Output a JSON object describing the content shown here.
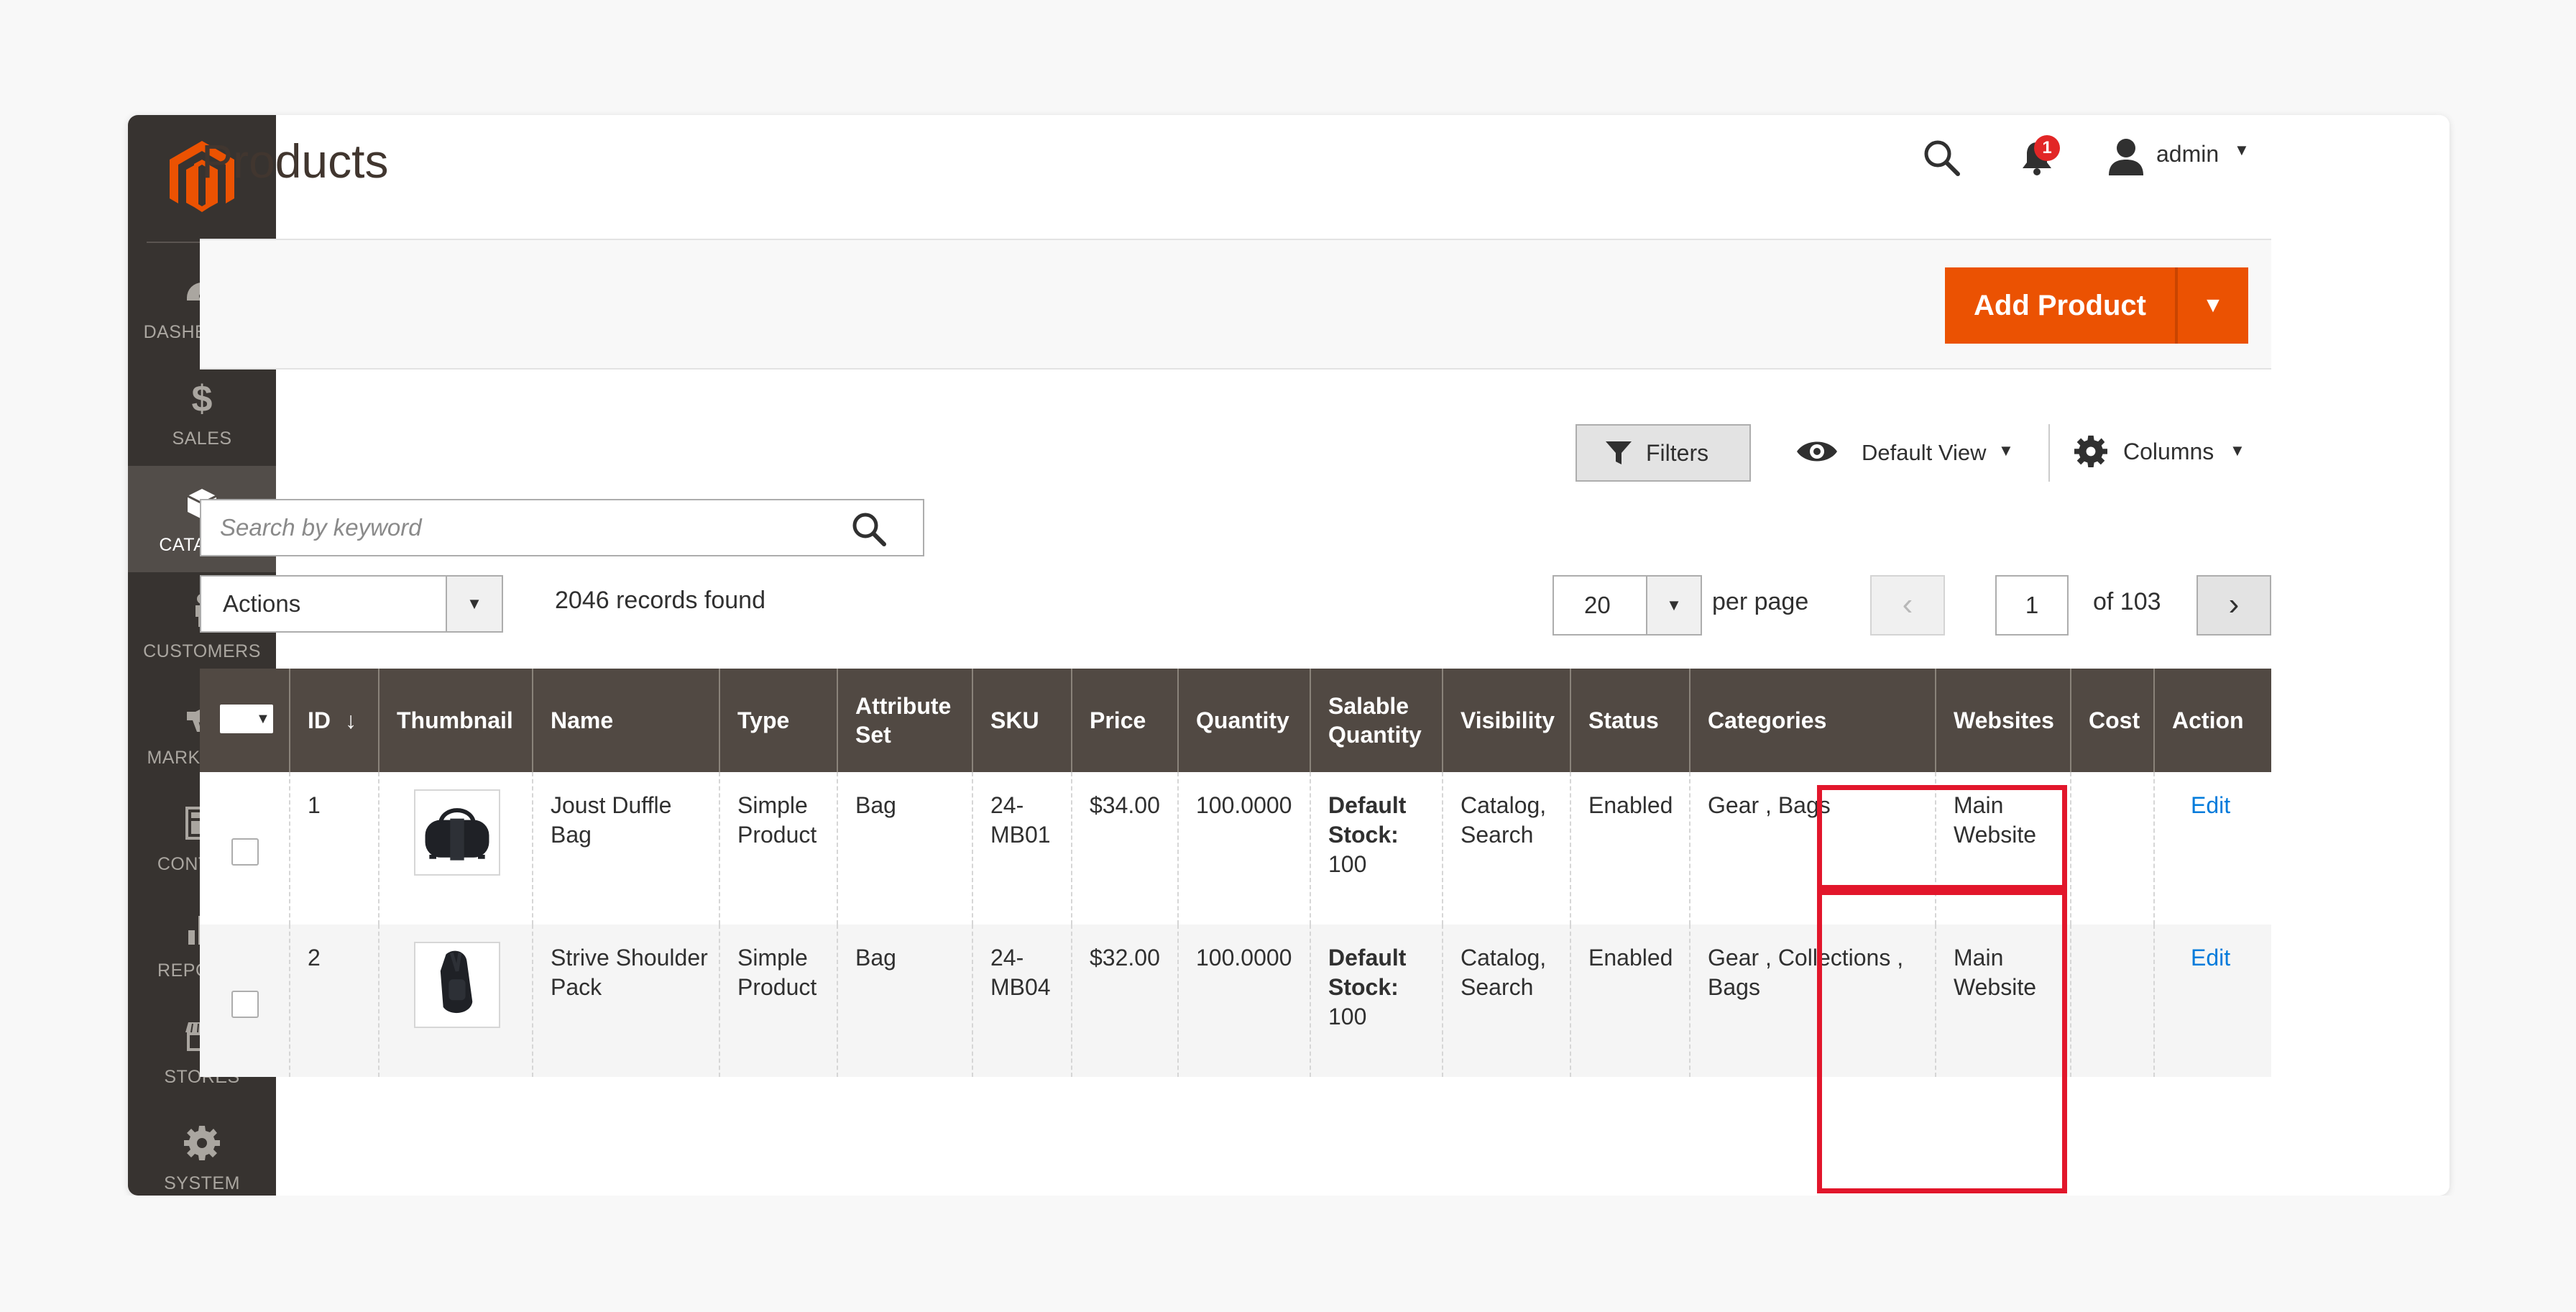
{
  "sidebar": {
    "items": [
      {
        "label": "DASHBOARD",
        "icon": "dashboard-icon"
      },
      {
        "label": "SALES",
        "icon": "dollar-icon"
      },
      {
        "label": "CATALOG",
        "icon": "cube-icon",
        "active": true
      },
      {
        "label": "CUSTOMERS",
        "icon": "person-icon"
      },
      {
        "label": "MARKETING",
        "icon": "megaphone-icon"
      },
      {
        "label": "CONTENT",
        "icon": "layout-icon"
      },
      {
        "label": "REPORTS",
        "icon": "bar-chart-icon"
      },
      {
        "label": "STORES",
        "icon": "storefront-icon"
      },
      {
        "label": "SYSTEM",
        "icon": "gear-icon"
      }
    ]
  },
  "header": {
    "title": "Products",
    "notifications_count": "1",
    "user": "admin"
  },
  "actionbar": {
    "add_product_label": "Add Product"
  },
  "toolbar": {
    "filters_label": "Filters",
    "view_label": "Default View",
    "columns_label": "Columns",
    "search_placeholder": "Search by keyword",
    "actions_label": "Actions",
    "records_found": "2046 records found",
    "per_page_value": "20",
    "per_page_label": "per page",
    "page_current": "1",
    "page_total": "of 103"
  },
  "grid": {
    "columns": [
      "ID",
      "Thumbnail",
      "Name",
      "Type",
      "Attribute Set",
      "SKU",
      "Price",
      "Quantity",
      "Salable Quantity",
      "Visibility",
      "Status",
      "Categories",
      "Websites",
      "Cost",
      "Action"
    ],
    "sort_indicator": "↓",
    "rows": [
      {
        "id": "1",
        "thumbnail": "duffle-bag-thumbnail",
        "name": "Joust Duffle Bag",
        "type": "Simple Product",
        "attribute_set": "Bag",
        "sku": "24-MB01",
        "price": "$34.00",
        "quantity": "100.0000",
        "salable_label": "Default Stock",
        "salable_value": "100",
        "visibility": "Catalog, Search",
        "status": "Enabled",
        "categories": "Gear , Bags",
        "websites": "Main Website",
        "cost": "",
        "action": "Edit"
      },
      {
        "id": "2",
        "thumbnail": "shoulder-pack-thumbnail",
        "name": "Strive Shoulder Pack",
        "type": "Simple Product",
        "attribute_set": "Bag",
        "sku": "24-MB04",
        "price": "$32.00",
        "quantity": "100.0000",
        "salable_label": "Default Stock",
        "salable_value": "100",
        "visibility": "Catalog, Search",
        "status": "Enabled",
        "categories": "Gear , Collections , Bags",
        "websites": "Main Website",
        "cost": "",
        "action": "Edit"
      }
    ]
  },
  "colors": {
    "accent": "#eb5202",
    "sidebar": "#373330",
    "grid_header": "#514943",
    "highlight": "#e2162b",
    "link": "#007bdb"
  }
}
